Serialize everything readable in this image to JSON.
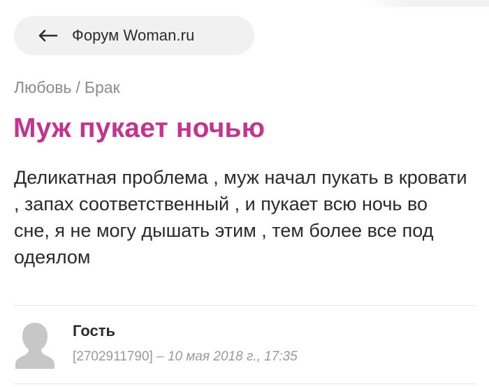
{
  "top_bar": {
    "back_label": "Форум Woman.ru"
  },
  "breadcrumb": {
    "category": "Любовь",
    "separator": "/",
    "subcategory": "Брак"
  },
  "post": {
    "title": "Муж пукает ночью",
    "body": "Деликатная проблема , муж начал пукать в кровати , запах соответственный , и пукает всю ночь во сне, я не могу дышать этим , тем более все под одеялом",
    "author": "Гость",
    "user_id": "[2702911790]",
    "dash": "–",
    "date": "10 мая 2018 г., 17:35"
  },
  "colors": {
    "title": "#c3338f",
    "pill_bg": "#f1f1f2",
    "muted": "#8c8c8c"
  },
  "icons": {
    "back": "arrow-left-icon",
    "avatar": "guest-avatar-icon"
  }
}
